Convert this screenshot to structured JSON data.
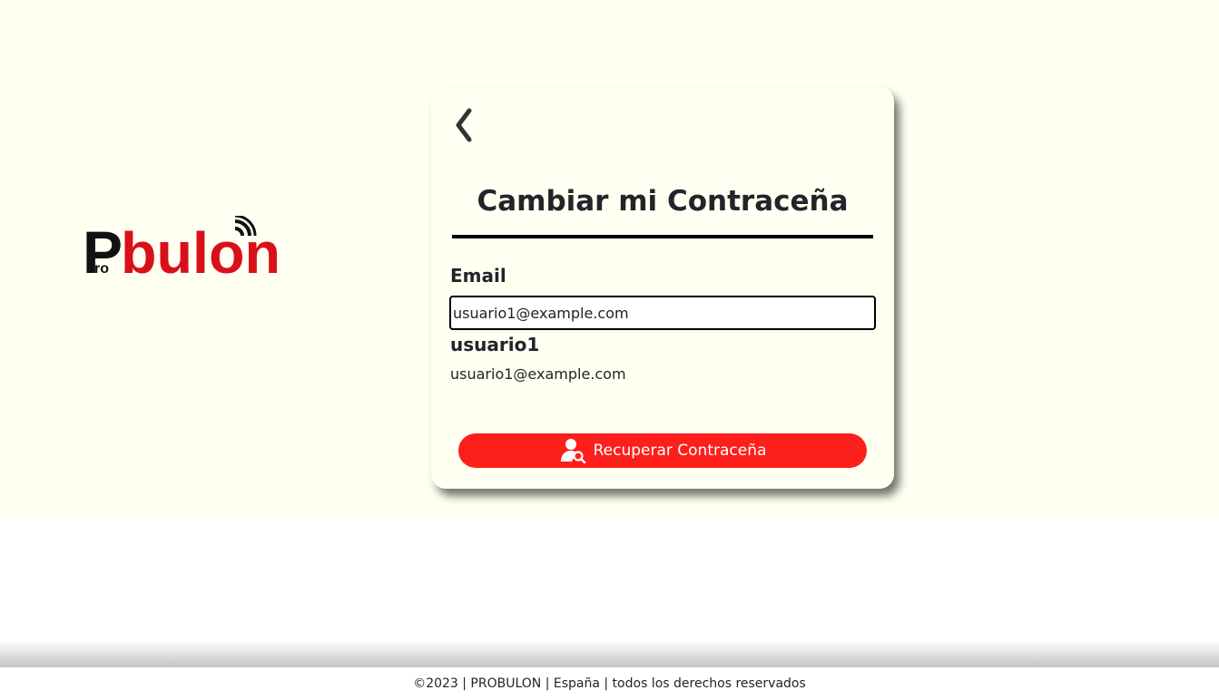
{
  "logo": {
    "text_prefix": "P",
    "text_small": "ro",
    "text_main": "bulon"
  },
  "card": {
    "back_icon": "chevron-left-icon",
    "title": "Cambiar mi Contraceña",
    "email_label": "Email",
    "email_value": "usuario1@example.com",
    "user": {
      "name": "usuario1",
      "email": "usuario1@example.com"
    },
    "button_icon": "user-search-icon",
    "button_label": "Recuperar Contraceña"
  },
  "footer": {
    "text": "©2023 | PROBULON | España | todos los derechos reservados"
  },
  "colors": {
    "background": "#fffff2",
    "accent": "#fc1f1c",
    "logo_red": "#d8101a",
    "text": "#212529"
  }
}
